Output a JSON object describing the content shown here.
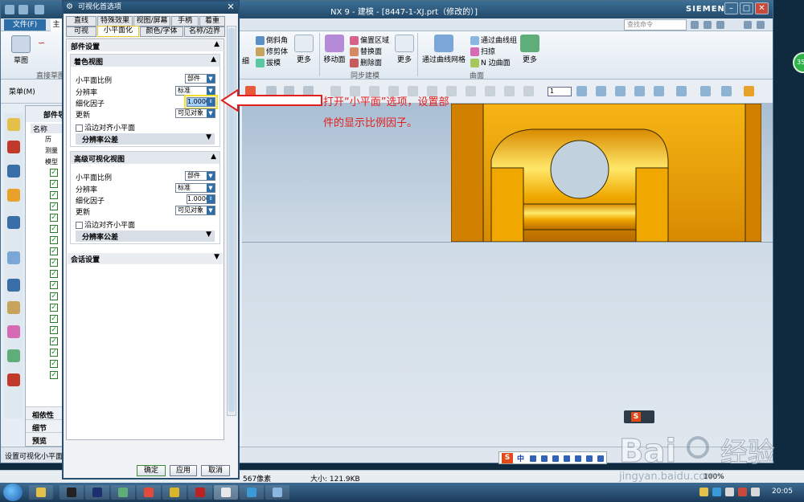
{
  "window": {
    "title": "NX 9 - 建模 - [8447-1-XJ.prt（修改的）]",
    "brand": "SIEMENS"
  },
  "menubar": {
    "file_label": "文件(F)",
    "home_tab": "主",
    "search_placeholder": "查找命令"
  },
  "ribbon": {
    "sketch_label": "草图",
    "direct_sketch_group": "直接草图",
    "features": {
      "item1": "细",
      "chamfer": "倒斜角",
      "trim_body": "修剪体",
      "draft": "拔模",
      "more1": "更多"
    },
    "sync": {
      "move_face": "移动面",
      "offset_region": "偏置区域",
      "replace_face": "替换面",
      "delete_face": "删除面",
      "more2": "更多",
      "group_label": "同步建模"
    },
    "surface": {
      "curve_mesh": "通过曲线网格",
      "through_curves": "通过曲线组",
      "sweep": "扫掠",
      "n_sided": "N 边曲面",
      "more3": "更多",
      "group_label": "曲面"
    }
  },
  "toolbar2": {
    "menu_label": "菜单(M)",
    "zoom_value": "1"
  },
  "part_nav": {
    "title": "部件导",
    "col_name": "名称",
    "rows": [
      "历",
      "测量",
      "模型"
    ],
    "dependencies": "相依性",
    "details": "细节",
    "preview": "预览"
  },
  "status": {
    "text": "设置可视化小平面",
    "pixels": "567像素",
    "size": "大小: 121.9KB",
    "zoom": "100%"
  },
  "dialog": {
    "title": "可视化首选项",
    "tabs_row1": [
      "直线",
      "特殊效果",
      "视图/屏幕",
      "手柄",
      "着重"
    ],
    "tabs_row2": [
      "可视",
      "小平面化",
      "颜色/字体",
      "名称/边界"
    ],
    "part_settings": "部件设置",
    "shaded_view": {
      "header": "着色视图",
      "facet_ratio_label": "小平面比例",
      "facet_ratio_value": "部件",
      "resolution_label": "分辨率",
      "resolution_value": "标准",
      "refine_factor_label": "细化因子",
      "refine_factor_value": "1.0000",
      "update_label": "更新",
      "update_value": "可见对象",
      "align_edges_label": "沿边对齐小平面",
      "tolerance_label": "分辨率公差"
    },
    "advanced_view": {
      "header": "高级可视化视图",
      "facet_ratio_label": "小平面比例",
      "facet_ratio_value": "部件",
      "resolution_label": "分辨率",
      "resolution_value": "标准",
      "refine_factor_label": "细化因子",
      "refine_factor_value": "1.0000",
      "update_label": "更新",
      "update_value": "可见对象",
      "align_edges_label": "沿边对齐小平面",
      "tolerance_label": "分辨率公差"
    },
    "session_settings": "会话设置",
    "ok": "确定",
    "apply": "应用",
    "cancel": "取消"
  },
  "annotation": {
    "line1": "打开“小平面”选项，设置部",
    "line2": "件的显示比例因子。",
    "color": "#e31e1e"
  },
  "ime": {
    "lang": "中"
  },
  "badge": {
    "value": "35"
  },
  "watermark": {
    "brand": "Bai",
    "brand2": "经验",
    "url": "jingyan.baidu.com"
  },
  "taskbar": {
    "clock": "20:05"
  },
  "colors": {
    "accent": "#2e6ea8",
    "part_body": "#f0a000",
    "highlight": "#f0e02c"
  }
}
